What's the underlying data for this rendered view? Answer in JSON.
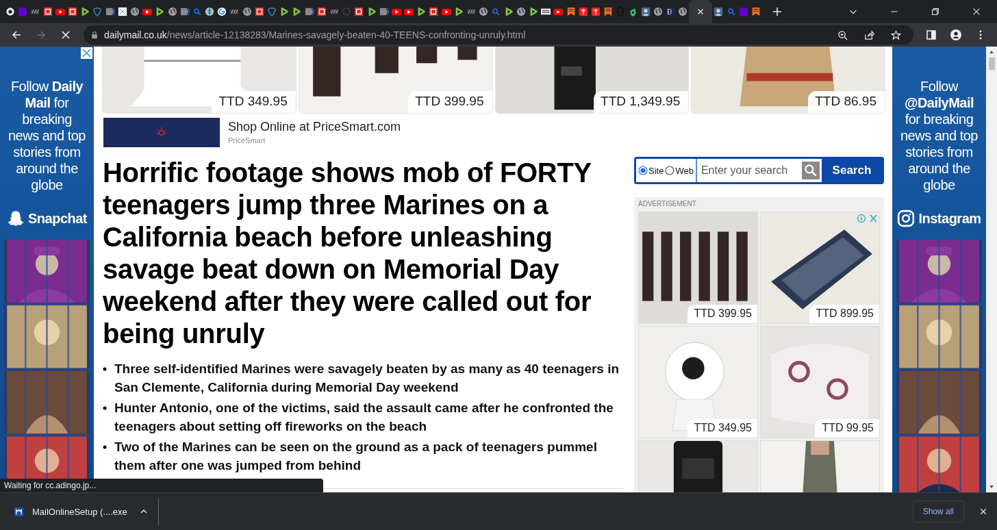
{
  "tabs": [
    {
      "kind": "ring",
      "selected": false
    },
    {
      "kind": "square",
      "selected": false
    },
    {
      "kind": "letters",
      "selected": false
    },
    {
      "kind": "red",
      "selected": false
    },
    {
      "kind": "video",
      "selected": false
    },
    {
      "kind": "red",
      "selected": false
    },
    {
      "kind": "play",
      "selected": false
    },
    {
      "kind": "shield",
      "selected": false
    },
    {
      "kind": "arrow",
      "selected": false
    },
    {
      "kind": "grid",
      "selected": false
    },
    {
      "kind": "globe",
      "selected": false
    },
    {
      "kind": "video",
      "selected": false
    },
    {
      "kind": "play",
      "selected": false
    },
    {
      "kind": "globe",
      "selected": false
    },
    {
      "kind": "arrow",
      "selected": false
    },
    {
      "kind": "search",
      "selected": false
    },
    {
      "kind": "tree",
      "selected": false
    },
    {
      "kind": "multi",
      "selected": false
    },
    {
      "kind": "letters",
      "selected": false
    },
    {
      "kind": "globe",
      "selected": false
    },
    {
      "kind": "red",
      "selected": false
    },
    {
      "kind": "shield",
      "selected": false
    },
    {
      "kind": "play",
      "selected": false
    },
    {
      "kind": "play",
      "selected": false
    },
    {
      "kind": "arrow",
      "selected": false
    },
    {
      "kind": "red",
      "selected": false
    },
    {
      "kind": "letters",
      "selected": false
    },
    {
      "kind": "blank",
      "selected": false
    },
    {
      "kind": "red",
      "selected": false
    },
    {
      "kind": "play",
      "selected": false
    },
    {
      "kind": "arrow",
      "selected": false
    },
    {
      "kind": "video",
      "selected": false
    },
    {
      "kind": "video",
      "selected": false
    },
    {
      "kind": "play",
      "selected": false
    },
    {
      "kind": "red",
      "selected": false
    },
    {
      "kind": "video",
      "selected": false
    },
    {
      "kind": "play",
      "selected": false
    },
    {
      "kind": "letters",
      "selected": false
    },
    {
      "kind": "globe",
      "selected": false
    },
    {
      "kind": "search",
      "selected": false
    },
    {
      "kind": "play",
      "selected": false
    },
    {
      "kind": "globe",
      "selected": false
    },
    {
      "kind": "play",
      "selected": false
    },
    {
      "kind": "news",
      "selected": false
    },
    {
      "kind": "video",
      "selected": false
    },
    {
      "kind": "bookmark",
      "selected": false
    },
    {
      "kind": "torch",
      "selected": false
    },
    {
      "kind": "torch",
      "selected": false
    },
    {
      "kind": "bookmark",
      "selected": false
    },
    {
      "kind": "theta",
      "selected": false
    },
    {
      "kind": "hook",
      "selected": false
    },
    {
      "kind": "person",
      "selected": false
    },
    {
      "kind": "globe",
      "selected": false
    },
    {
      "kind": "navy",
      "selected": false
    },
    {
      "kind": "globe",
      "selected": false
    },
    {
      "selected": true
    },
    {
      "kind": "person",
      "selected": false
    },
    {
      "kind": "search",
      "selected": false
    },
    {
      "kind": "square",
      "selected": false
    },
    {
      "kind": "bookmark",
      "selected": false
    }
  ],
  "toolbar": {
    "forward_disabled": true,
    "loading": true
  },
  "url": {
    "host": "dailymail.co.uk",
    "path": "/news/article-12138283/Marines-savagely-beaten-40-TEENS-confronting-unruly.html"
  },
  "left_ad": {
    "text": "Follow **Daily Mail** for breaking news and top stories from around the globe",
    "brand": "Snapchat",
    "kind": "ghost"
  },
  "right_ad": {
    "text": "Follow **@DailyMail** for breaking news and top stories from around the globe",
    "brand": "Instagram",
    "kind": "camera"
  },
  "top_products": [
    {
      "price": "TTD 349.95"
    },
    {
      "price": "TTD 399.95"
    },
    {
      "price": "TTD 1,349.95"
    },
    {
      "price": "TTD 86.95"
    }
  ],
  "shop_ad": {
    "title": "Shop Online at PriceSmart.com",
    "advertiser": "PriceSmart"
  },
  "headline": "Horrific footage shows mob of FORTY teenagers jump three Marines on a California beach before unleashing savage beat down on Memorial Day weekend after they were called out for being unruly",
  "bullets": [
    "Three self-identified Marines were savagely beaten by as many as 40 teenagers in San Clemente, California during Memorial Day weekend",
    "Hunter Antonio, one of the victims, said the assault came after he confronted the teenagers about setting off fireworks on the beach",
    "Two of the Marines can be seen on the ground as a pack of teenagers pummel them after one was jumped from behind"
  ],
  "search": {
    "options": [
      {
        "label": "Site",
        "selected": true
      },
      {
        "label": "Web",
        "selected": false
      }
    ],
    "placeholder": "Enter your search",
    "button": "Search"
  },
  "ad_panel": {
    "label": "ADVERTISEMENT",
    "products": [
      {
        "kind": "picture",
        "price": "TTD 399.95"
      },
      {
        "kind": "picture",
        "price": "TTD 899.95"
      },
      {
        "kind": "picture",
        "price": "TTD 349.95"
      },
      {
        "kind": "picture",
        "price": "TTD 99.95"
      },
      {
        "kind": "picture"
      },
      {
        "kind": "picture"
      }
    ]
  },
  "status": "Waiting for cc.adingo.jp...",
  "download": {
    "file": "MailOnlineSetup (....exe",
    "show_all": "Show all"
  }
}
